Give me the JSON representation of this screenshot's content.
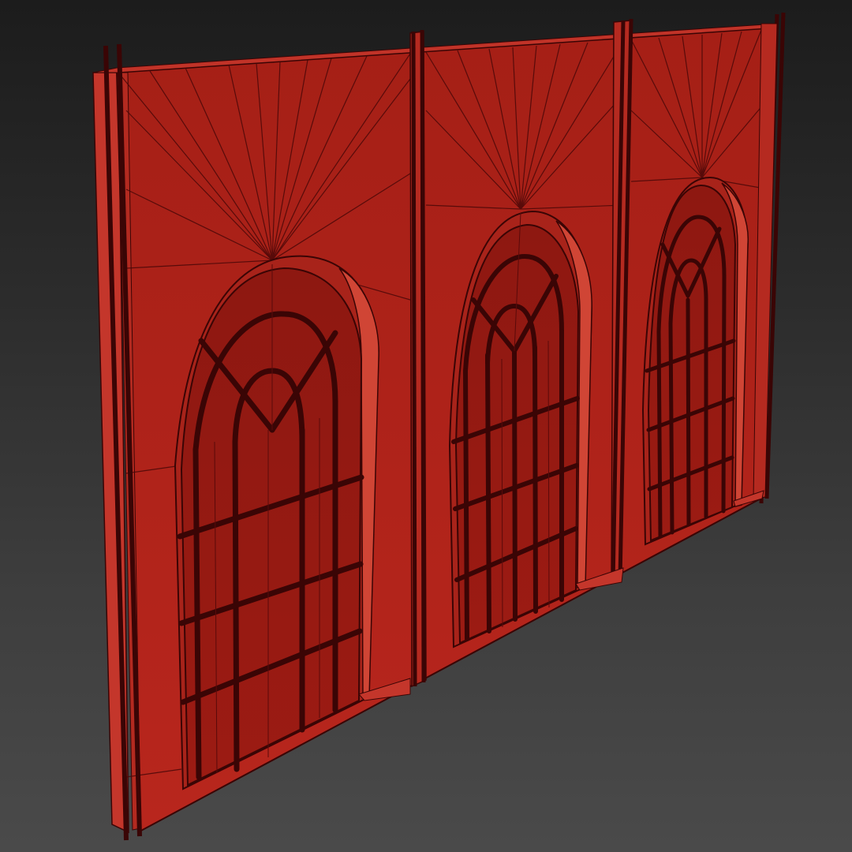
{
  "viewport": {
    "view": "perspective",
    "shading": "edged-faces",
    "background_colors": [
      "#1c1c1c",
      "#4a4a4a"
    ]
  },
  "model": {
    "object": "wall-with-arched-windows",
    "color": "#b8261d",
    "edge_color": "#3a0505",
    "window_count": 3
  }
}
